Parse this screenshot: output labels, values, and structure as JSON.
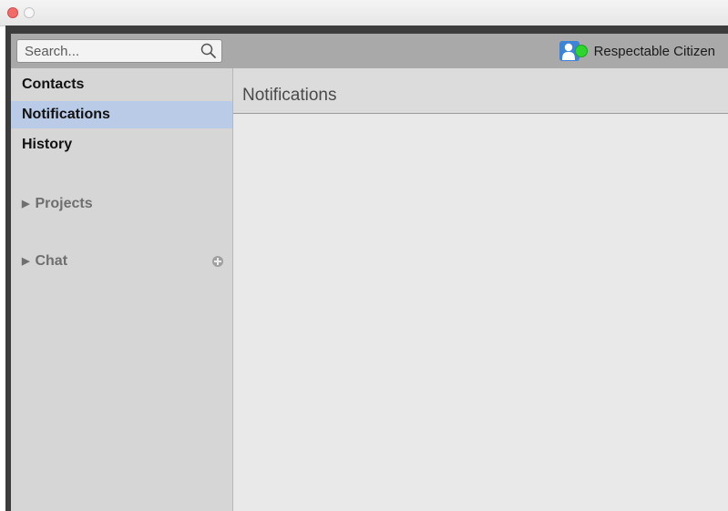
{
  "window": {
    "controls": [
      "close",
      "minimize"
    ]
  },
  "search": {
    "placeholder": "Search...",
    "value": "",
    "icon": "magnifier"
  },
  "user": {
    "name": "Respectable Citizen",
    "status": "online",
    "status_color": "#2ed52e",
    "avatar_color": "#3f83d6"
  },
  "sidebar": {
    "items": [
      {
        "label": "Contacts",
        "selected": false
      },
      {
        "label": "Notifications",
        "selected": true
      },
      {
        "label": "History",
        "selected": false
      }
    ],
    "groups": [
      {
        "label": "Projects",
        "collapsed": true
      },
      {
        "label": "Chat",
        "collapsed": true,
        "add_icon": "plus-circle"
      }
    ],
    "selection_color": "#b9cbe6"
  },
  "main": {
    "title": "Notifications"
  }
}
